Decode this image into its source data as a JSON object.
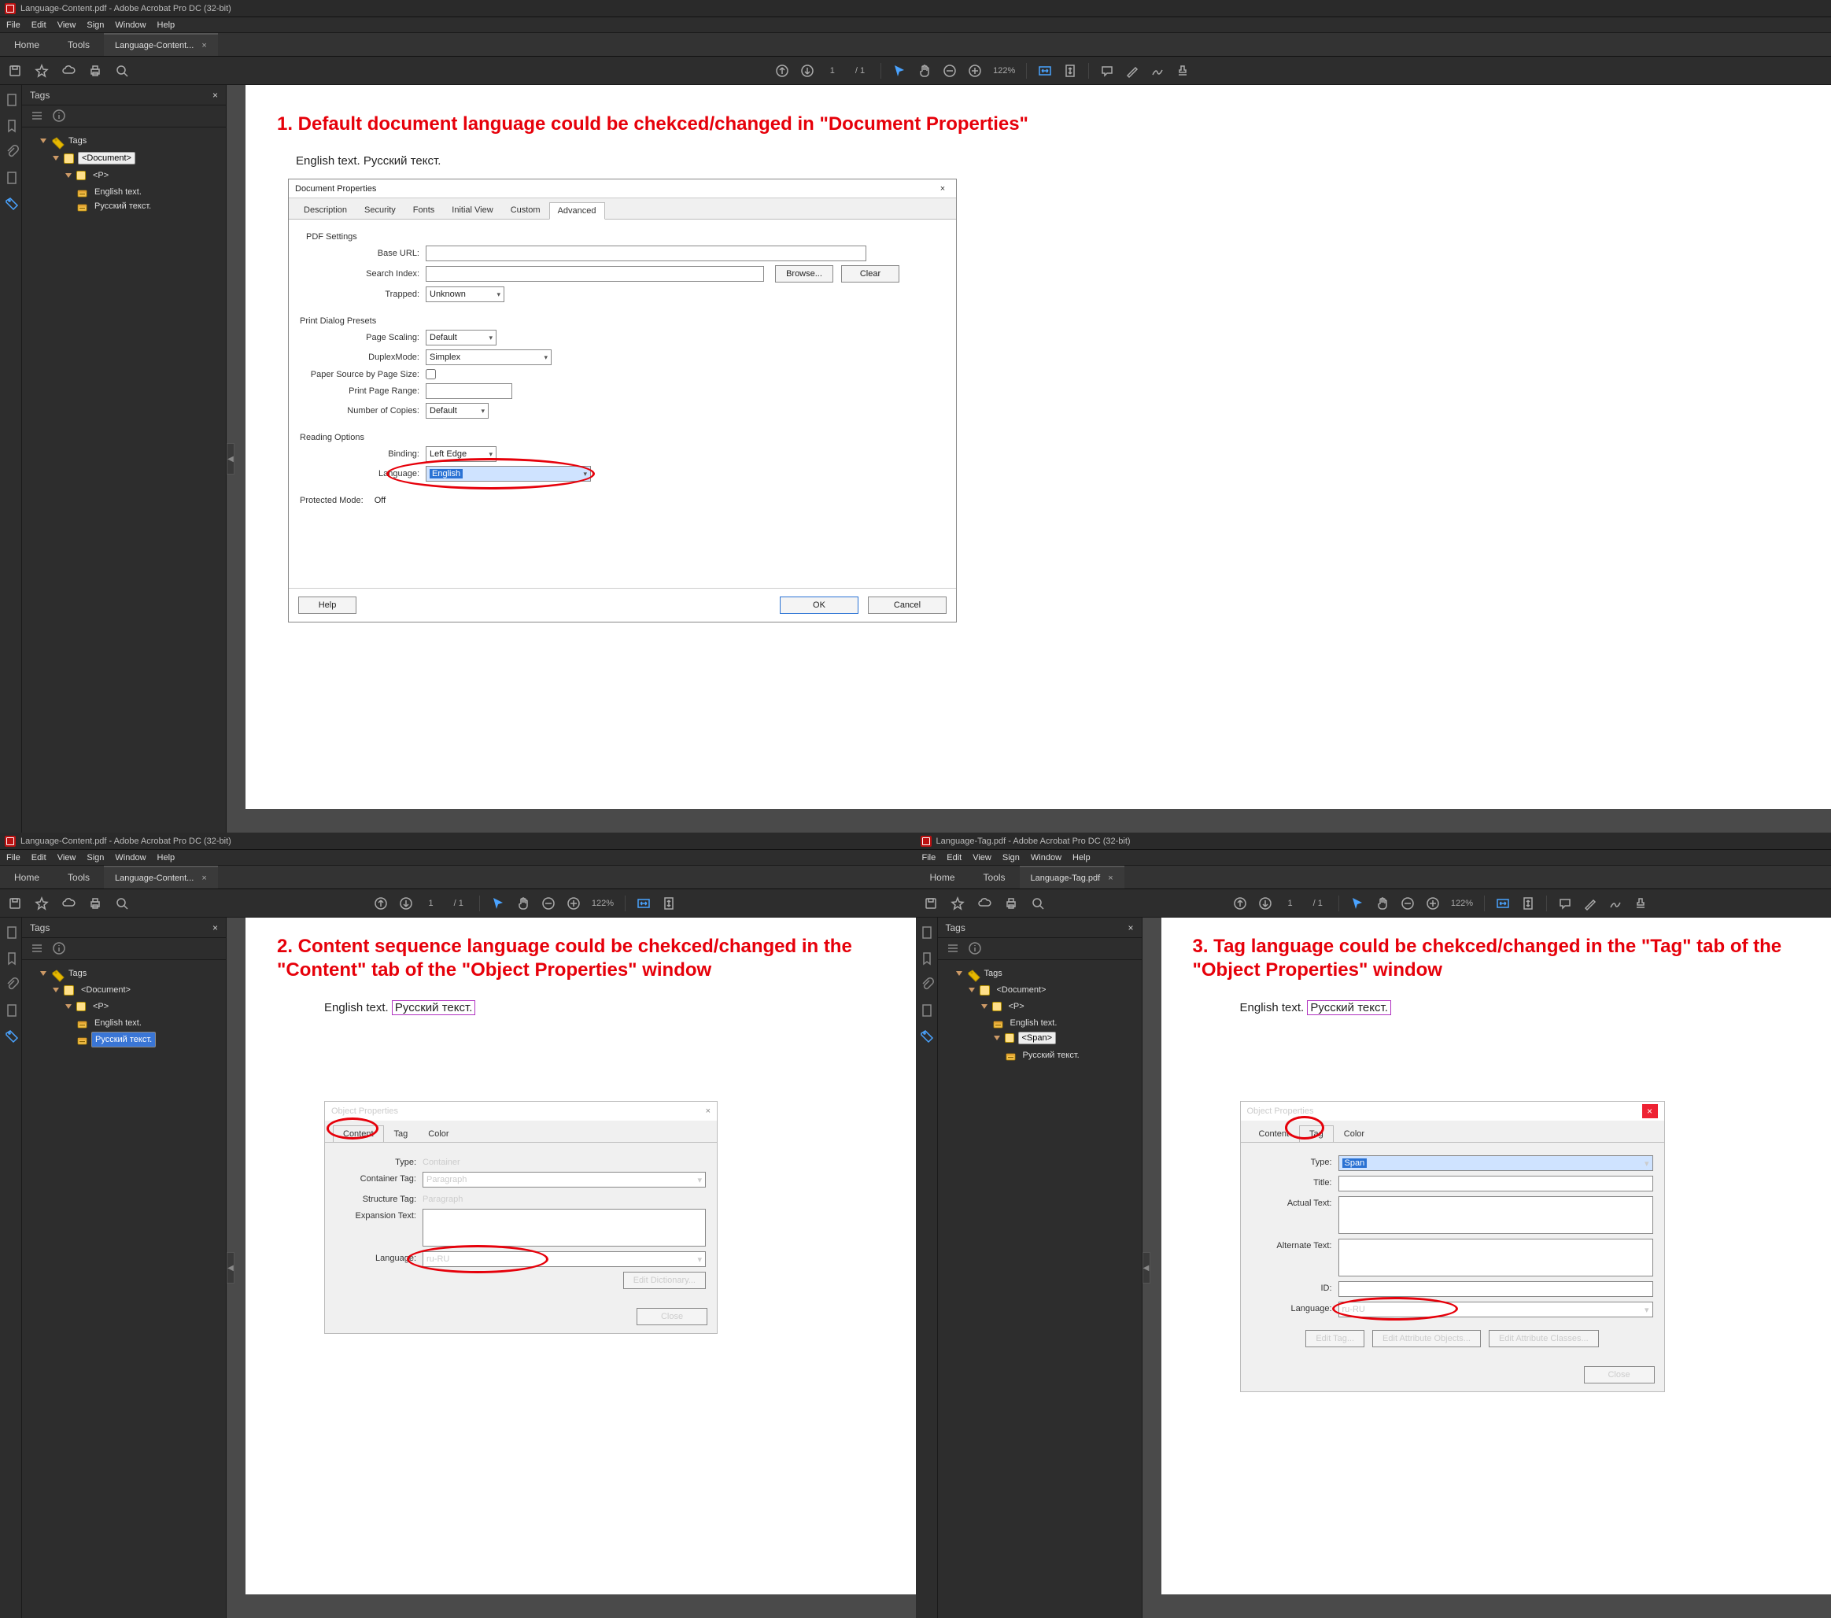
{
  "app_title_1": "Language-Content.pdf - Adobe Acrobat Pro DC (32-bit)",
  "app_title_3": "Language-Tag.pdf - Adobe Acrobat Pro DC (32-bit)",
  "menus": [
    "File",
    "Edit",
    "View",
    "Sign",
    "Window",
    "Help"
  ],
  "tabrow": {
    "home": "Home",
    "tools": "Tools",
    "doc1": "Language-Content...",
    "doc3": "Language-Tag.pdf",
    "close": "×"
  },
  "toolbar": {
    "page_cur": "1",
    "page_sep": "/ 1",
    "zoom": "122%"
  },
  "tags_panel": {
    "title": "Tags",
    "close": "×",
    "root": "Tags",
    "document": "<Document>",
    "p": "<P>",
    "span": "<Span>",
    "leaf_en": "English text.",
    "leaf_ru": "Русский текст."
  },
  "callouts": {
    "c1": "1. Default document language could be chekced/changed in \"Document Properties\"",
    "c2": "2. Content sequence language could be chekced/changed in the \"Content\" tab of the \"Object Properties\" window",
    "c3": "3. Tag language could be chekced/changed in the \"Tag\" tab of the \"Object Properties\" window"
  },
  "body_line": {
    "en": "English text. ",
    "ru": "Русский текст."
  },
  "doc_props": {
    "title": "Document Properties",
    "tabs": [
      "Description",
      "Security",
      "Fonts",
      "Initial View",
      "Custom",
      "Advanced"
    ],
    "active_tab": "Advanced",
    "grp_pdf": "PDF Settings",
    "base_url": "Base URL:",
    "search_index": "Search Index:",
    "browse": "Browse...",
    "clear": "Clear",
    "trapped": "Trapped:",
    "trapped_val": "Unknown",
    "grp_print": "Print Dialog Presets",
    "page_scaling": "Page Scaling:",
    "page_scaling_val": "Default",
    "duplex": "DuplexMode:",
    "duplex_val": "Simplex",
    "paper_by_size": "Paper Source by Page Size:",
    "print_range": "Print Page Range:",
    "copies": "Number of Copies:",
    "copies_val": "Default",
    "grp_reading": "Reading Options",
    "binding": "Binding:",
    "binding_val": "Left Edge",
    "language": "Language:",
    "language_val": "English",
    "protected": "Protected Mode:",
    "protected_val": "Off",
    "help": "Help",
    "ok": "OK",
    "cancel": "Cancel"
  },
  "obj_props_content": {
    "title": "Object Properties",
    "tabs": [
      "Content",
      "Tag",
      "Color"
    ],
    "active": "Content",
    "type_l": "Type:",
    "type_v": "Container",
    "ctag_l": "Container Tag:",
    "ctag_v": "Paragraph",
    "stag_l": "Structure Tag:",
    "stag_v": "Paragraph",
    "exp_l": "Expansion Text:",
    "lang_l": "Language:",
    "lang_v": "ru-RU",
    "edit_dict": "Edit Dictionary...",
    "close": "Close"
  },
  "obj_props_tag": {
    "title": "Object Properties",
    "tabs": [
      "Content",
      "Tag",
      "Color"
    ],
    "active": "Tag",
    "type_l": "Type:",
    "type_v": "Span",
    "title_l": "Title:",
    "actual_l": "Actual Text:",
    "alt_l": "Alternate Text:",
    "id_l": "ID:",
    "lang_l": "Language:",
    "lang_v": "ru-RU",
    "edit_tag": "Edit Tag...",
    "edit_attr_obj": "Edit Attribute Objects...",
    "edit_attr_cls": "Edit Attribute Classes...",
    "close": "Close"
  }
}
